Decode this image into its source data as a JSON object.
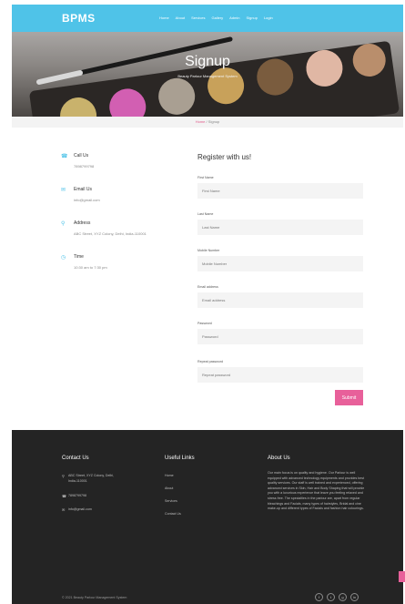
{
  "brand": {
    "logo": "BPMS",
    "accent": "#4fc3e8",
    "pink": "#e8609a"
  },
  "nav": [
    "Home",
    "About",
    "Services",
    "Gallery",
    "Admin",
    "Signup",
    "Login"
  ],
  "hero": {
    "title": "Signup",
    "subtitle": "Beauty Parlour Management System"
  },
  "breadcrumb": {
    "home": "Home",
    "separator": "/",
    "current": "Signup"
  },
  "contact": [
    {
      "icon": "phone-icon",
      "label": "Call Us",
      "value": "7898799798"
    },
    {
      "icon": "envelope-icon",
      "label": "Email Us",
      "value": "info@gmail.com"
    },
    {
      "icon": "map-marker-icon",
      "label": "Address",
      "value": "ABC Street, XYZ Colony, Delhi, India-110001"
    },
    {
      "icon": "clock-icon",
      "label": "Time",
      "value": "10:30 am to 7:30 pm"
    }
  ],
  "form": {
    "title": "Register with us!",
    "fields": [
      {
        "label": "First Name",
        "placeholder": "First Name"
      },
      {
        "label": "Last Name",
        "placeholder": "Last Name"
      },
      {
        "label": "Mobile Number",
        "placeholder": "Mobile Number"
      },
      {
        "label": "Email address",
        "placeholder": "Email address"
      },
      {
        "label": "Password",
        "placeholder": "Password"
      },
      {
        "label": "Repeat password",
        "placeholder": "Repeat password"
      }
    ],
    "submit": "Submit"
  },
  "footer": {
    "contact_heading": "Contact Us",
    "address": [
      "ABC Street, XYZ Colony, Delhi,",
      "India-110001"
    ],
    "phone": "7898799798",
    "email": "info@gmail.com",
    "links_heading": "Useful Links",
    "links": [
      "Home",
      "About",
      "Services",
      "Contact Us"
    ],
    "about_heading": "About Us",
    "about_text": "Our main focus is on quality and hygiene. Our Parlour is well equipped with advanced technology equipments and provides best quality services. Our staff is well trained and experienced, offering advanced services in Skin, Hair and Body Shaping that will provide you with a luxurious experience that leave you feeling relaxed and stress free. The specialties in the parlour are, apart from regular bleachings and Facials, many types of hairstyles, Bridal and cine make-up and different types of Facials and fashion hair colourings.",
    "copyright": "© 2021 Beauty Parlour Management System",
    "social": [
      "f",
      "t",
      "g",
      "in"
    ]
  }
}
